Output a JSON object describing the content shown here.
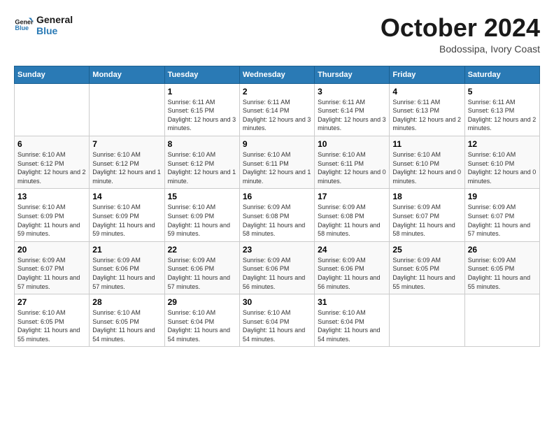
{
  "header": {
    "logo_line1": "General",
    "logo_line2": "Blue",
    "month": "October 2024",
    "location": "Bodossipa, Ivory Coast"
  },
  "weekdays": [
    "Sunday",
    "Monday",
    "Tuesday",
    "Wednesday",
    "Thursday",
    "Friday",
    "Saturday"
  ],
  "weeks": [
    [
      {
        "day": "",
        "info": ""
      },
      {
        "day": "",
        "info": ""
      },
      {
        "day": "1",
        "info": "Sunrise: 6:11 AM\nSunset: 6:15 PM\nDaylight: 12 hours and 3 minutes."
      },
      {
        "day": "2",
        "info": "Sunrise: 6:11 AM\nSunset: 6:14 PM\nDaylight: 12 hours and 3 minutes."
      },
      {
        "day": "3",
        "info": "Sunrise: 6:11 AM\nSunset: 6:14 PM\nDaylight: 12 hours and 3 minutes."
      },
      {
        "day": "4",
        "info": "Sunrise: 6:11 AM\nSunset: 6:13 PM\nDaylight: 12 hours and 2 minutes."
      },
      {
        "day": "5",
        "info": "Sunrise: 6:11 AM\nSunset: 6:13 PM\nDaylight: 12 hours and 2 minutes."
      }
    ],
    [
      {
        "day": "6",
        "info": "Sunrise: 6:10 AM\nSunset: 6:12 PM\nDaylight: 12 hours and 2 minutes."
      },
      {
        "day": "7",
        "info": "Sunrise: 6:10 AM\nSunset: 6:12 PM\nDaylight: 12 hours and 1 minute."
      },
      {
        "day": "8",
        "info": "Sunrise: 6:10 AM\nSunset: 6:12 PM\nDaylight: 12 hours and 1 minute."
      },
      {
        "day": "9",
        "info": "Sunrise: 6:10 AM\nSunset: 6:11 PM\nDaylight: 12 hours and 1 minute."
      },
      {
        "day": "10",
        "info": "Sunrise: 6:10 AM\nSunset: 6:11 PM\nDaylight: 12 hours and 0 minutes."
      },
      {
        "day": "11",
        "info": "Sunrise: 6:10 AM\nSunset: 6:10 PM\nDaylight: 12 hours and 0 minutes."
      },
      {
        "day": "12",
        "info": "Sunrise: 6:10 AM\nSunset: 6:10 PM\nDaylight: 12 hours and 0 minutes."
      }
    ],
    [
      {
        "day": "13",
        "info": "Sunrise: 6:10 AM\nSunset: 6:09 PM\nDaylight: 11 hours and 59 minutes."
      },
      {
        "day": "14",
        "info": "Sunrise: 6:10 AM\nSunset: 6:09 PM\nDaylight: 11 hours and 59 minutes."
      },
      {
        "day": "15",
        "info": "Sunrise: 6:10 AM\nSunset: 6:09 PM\nDaylight: 11 hours and 59 minutes."
      },
      {
        "day": "16",
        "info": "Sunrise: 6:09 AM\nSunset: 6:08 PM\nDaylight: 11 hours and 58 minutes."
      },
      {
        "day": "17",
        "info": "Sunrise: 6:09 AM\nSunset: 6:08 PM\nDaylight: 11 hours and 58 minutes."
      },
      {
        "day": "18",
        "info": "Sunrise: 6:09 AM\nSunset: 6:07 PM\nDaylight: 11 hours and 58 minutes."
      },
      {
        "day": "19",
        "info": "Sunrise: 6:09 AM\nSunset: 6:07 PM\nDaylight: 11 hours and 57 minutes."
      }
    ],
    [
      {
        "day": "20",
        "info": "Sunrise: 6:09 AM\nSunset: 6:07 PM\nDaylight: 11 hours and 57 minutes."
      },
      {
        "day": "21",
        "info": "Sunrise: 6:09 AM\nSunset: 6:06 PM\nDaylight: 11 hours and 57 minutes."
      },
      {
        "day": "22",
        "info": "Sunrise: 6:09 AM\nSunset: 6:06 PM\nDaylight: 11 hours and 57 minutes."
      },
      {
        "day": "23",
        "info": "Sunrise: 6:09 AM\nSunset: 6:06 PM\nDaylight: 11 hours and 56 minutes."
      },
      {
        "day": "24",
        "info": "Sunrise: 6:09 AM\nSunset: 6:06 PM\nDaylight: 11 hours and 56 minutes."
      },
      {
        "day": "25",
        "info": "Sunrise: 6:09 AM\nSunset: 6:05 PM\nDaylight: 11 hours and 55 minutes."
      },
      {
        "day": "26",
        "info": "Sunrise: 6:09 AM\nSunset: 6:05 PM\nDaylight: 11 hours and 55 minutes."
      }
    ],
    [
      {
        "day": "27",
        "info": "Sunrise: 6:10 AM\nSunset: 6:05 PM\nDaylight: 11 hours and 55 minutes."
      },
      {
        "day": "28",
        "info": "Sunrise: 6:10 AM\nSunset: 6:05 PM\nDaylight: 11 hours and 54 minutes."
      },
      {
        "day": "29",
        "info": "Sunrise: 6:10 AM\nSunset: 6:04 PM\nDaylight: 11 hours and 54 minutes."
      },
      {
        "day": "30",
        "info": "Sunrise: 6:10 AM\nSunset: 6:04 PM\nDaylight: 11 hours and 54 minutes."
      },
      {
        "day": "31",
        "info": "Sunrise: 6:10 AM\nSunset: 6:04 PM\nDaylight: 11 hours and 54 minutes."
      },
      {
        "day": "",
        "info": ""
      },
      {
        "day": "",
        "info": ""
      }
    ]
  ]
}
